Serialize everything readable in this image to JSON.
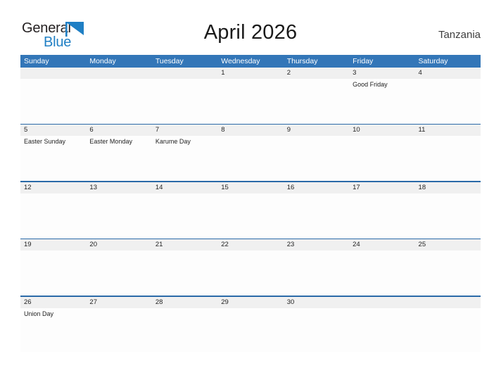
{
  "brand": {
    "name_part1": "General",
    "name_part2": "Blue",
    "triangle_color": "#1f7fc4",
    "text_color_primary": "#231f20",
    "text_color_secondary": "#1f7fc4"
  },
  "header": {
    "title": "April 2026",
    "country": "Tanzania"
  },
  "theme": {
    "header_blue": "#3376b8",
    "divider_blue": "#2a6aa8",
    "date_band_gray": "#f0f0f0",
    "cell_background": "#fdfdfd",
    "page_background": "#ffffff"
  },
  "calendar": {
    "day_headers": [
      "Sunday",
      "Monday",
      "Tuesday",
      "Wednesday",
      "Thursday",
      "Friday",
      "Saturday"
    ],
    "weeks": [
      {
        "days": [
          {
            "date": "",
            "events": []
          },
          {
            "date": "",
            "events": []
          },
          {
            "date": "",
            "events": []
          },
          {
            "date": "1",
            "events": []
          },
          {
            "date": "2",
            "events": []
          },
          {
            "date": "3",
            "events": [
              "Good Friday"
            ]
          },
          {
            "date": "4",
            "events": []
          }
        ]
      },
      {
        "days": [
          {
            "date": "5",
            "events": [
              "Easter Sunday"
            ]
          },
          {
            "date": "6",
            "events": [
              "Easter Monday"
            ]
          },
          {
            "date": "7",
            "events": [
              "Karume Day"
            ]
          },
          {
            "date": "8",
            "events": []
          },
          {
            "date": "9",
            "events": []
          },
          {
            "date": "10",
            "events": []
          },
          {
            "date": "11",
            "events": []
          }
        ]
      },
      {
        "days": [
          {
            "date": "12",
            "events": []
          },
          {
            "date": "13",
            "events": []
          },
          {
            "date": "14",
            "events": []
          },
          {
            "date": "15",
            "events": []
          },
          {
            "date": "16",
            "events": []
          },
          {
            "date": "17",
            "events": []
          },
          {
            "date": "18",
            "events": []
          }
        ]
      },
      {
        "days": [
          {
            "date": "19",
            "events": []
          },
          {
            "date": "20",
            "events": []
          },
          {
            "date": "21",
            "events": []
          },
          {
            "date": "22",
            "events": []
          },
          {
            "date": "23",
            "events": []
          },
          {
            "date": "24",
            "events": []
          },
          {
            "date": "25",
            "events": []
          }
        ]
      },
      {
        "days": [
          {
            "date": "26",
            "events": [
              "Union Day"
            ]
          },
          {
            "date": "27",
            "events": []
          },
          {
            "date": "28",
            "events": []
          },
          {
            "date": "29",
            "events": []
          },
          {
            "date": "30",
            "events": []
          },
          {
            "date": "",
            "events": []
          },
          {
            "date": "",
            "events": []
          }
        ]
      }
    ]
  }
}
